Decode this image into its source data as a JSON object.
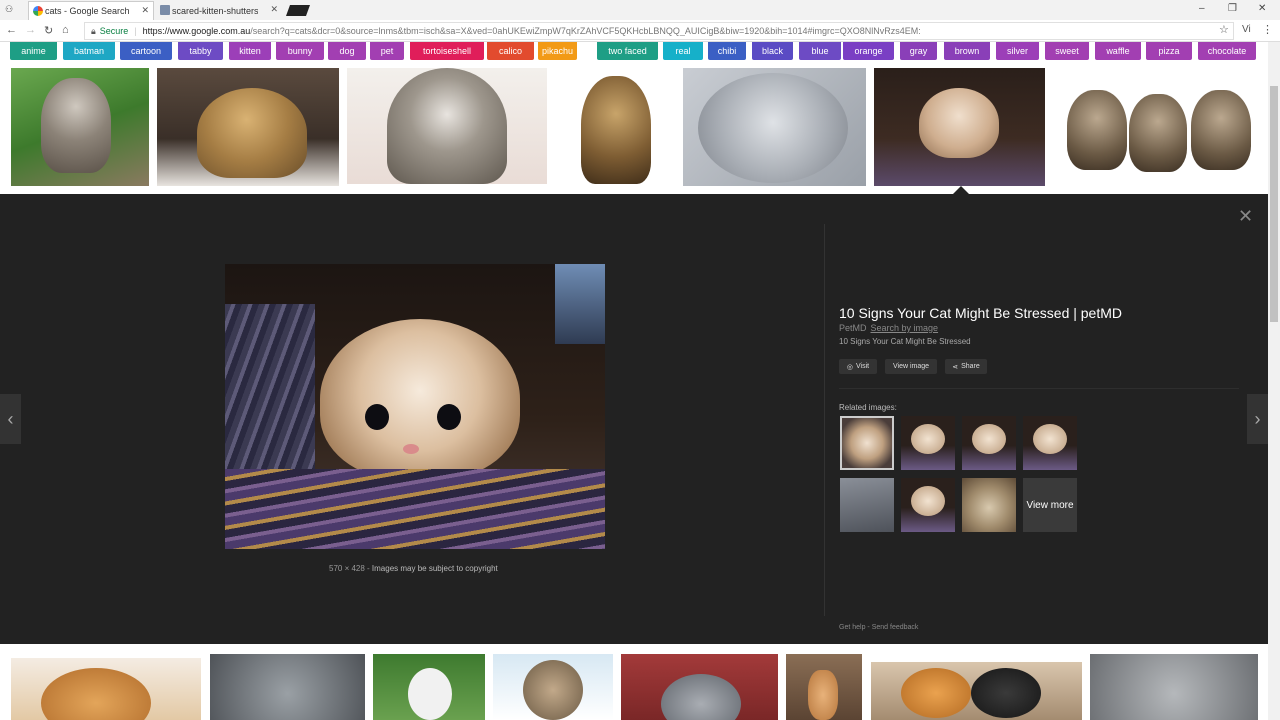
{
  "tabs": [
    {
      "title": "cats - Google Search",
      "active": true
    },
    {
      "title": "scared-kitten-shutterstock",
      "active": false
    }
  ],
  "window_controls": [
    "–",
    "❐",
    "✕"
  ],
  "address": {
    "secure_label": "Secure",
    "url_host": "https://www.google.com.au",
    "url_rest": "/search?q=cats&dcr=0&source=lnms&tbm=isch&sa=X&ved=0ahUKEwiZmpW7qKrZAhVCF5QKHcbLBNQQ_AUICigB&biw=1920&bih=1014#imgrc=QXO8NlNvRzs4EM:",
    "profile": "Vi"
  },
  "chips": [
    {
      "label": "anime",
      "color": "#1e9e85"
    },
    {
      "label": "batman",
      "color": "#1ea7c4"
    },
    {
      "label": "cartoon",
      "color": "#3b5fc4"
    },
    {
      "label": "tabby",
      "color": "#6d4bc4"
    },
    {
      "label": "kitten",
      "color": "#9c3fb8"
    },
    {
      "label": "bunny",
      "color": "#a23fb2"
    },
    {
      "label": "dog",
      "color": "#a23fb2"
    },
    {
      "label": "pet",
      "color": "#a23fb2"
    },
    {
      "label": "tortoiseshell",
      "color": "#e01e5a"
    },
    {
      "label": "calico",
      "color": "#e24b2e"
    },
    {
      "label": "pikachu",
      "color": "#f29a16"
    },
    {
      "label": "two faced",
      "color": "#1e9e85"
    },
    {
      "label": "real",
      "color": "#16b0c9"
    },
    {
      "label": "chibi",
      "color": "#3b5fc4"
    },
    {
      "label": "black",
      "color": "#5a4bc4"
    },
    {
      "label": "blue",
      "color": "#6d4bc4"
    },
    {
      "label": "orange",
      "color": "#7a3fc4"
    },
    {
      "label": "gray",
      "color": "#8a3fb8"
    },
    {
      "label": "brown",
      "color": "#8a3fb8"
    },
    {
      "label": "silver",
      "color": "#9c3fb8"
    },
    {
      "label": "sweet",
      "color": "#a23fb2"
    },
    {
      "label": "waffle",
      "color": "#a23fb2"
    },
    {
      "label": "pizza",
      "color": "#a23fb2"
    },
    {
      "label": "chocolate",
      "color": "#a23fb2"
    }
  ],
  "viewer": {
    "title": "10 Signs Your Cat Might Be Stressed | petMD",
    "source": "PetMD",
    "search_by_image": "Search by image",
    "description": "10 Signs Your Cat Might Be Stressed",
    "buttons": {
      "visit": "Visit",
      "view_image": "View image",
      "share": "Share"
    },
    "dimensions": "570 × 428",
    "copyright": "Images may be subject to copyright",
    "related_heading": "Related images:",
    "view_more": "View more",
    "get_help": "Get help",
    "send_feedback": "Send feedback"
  }
}
